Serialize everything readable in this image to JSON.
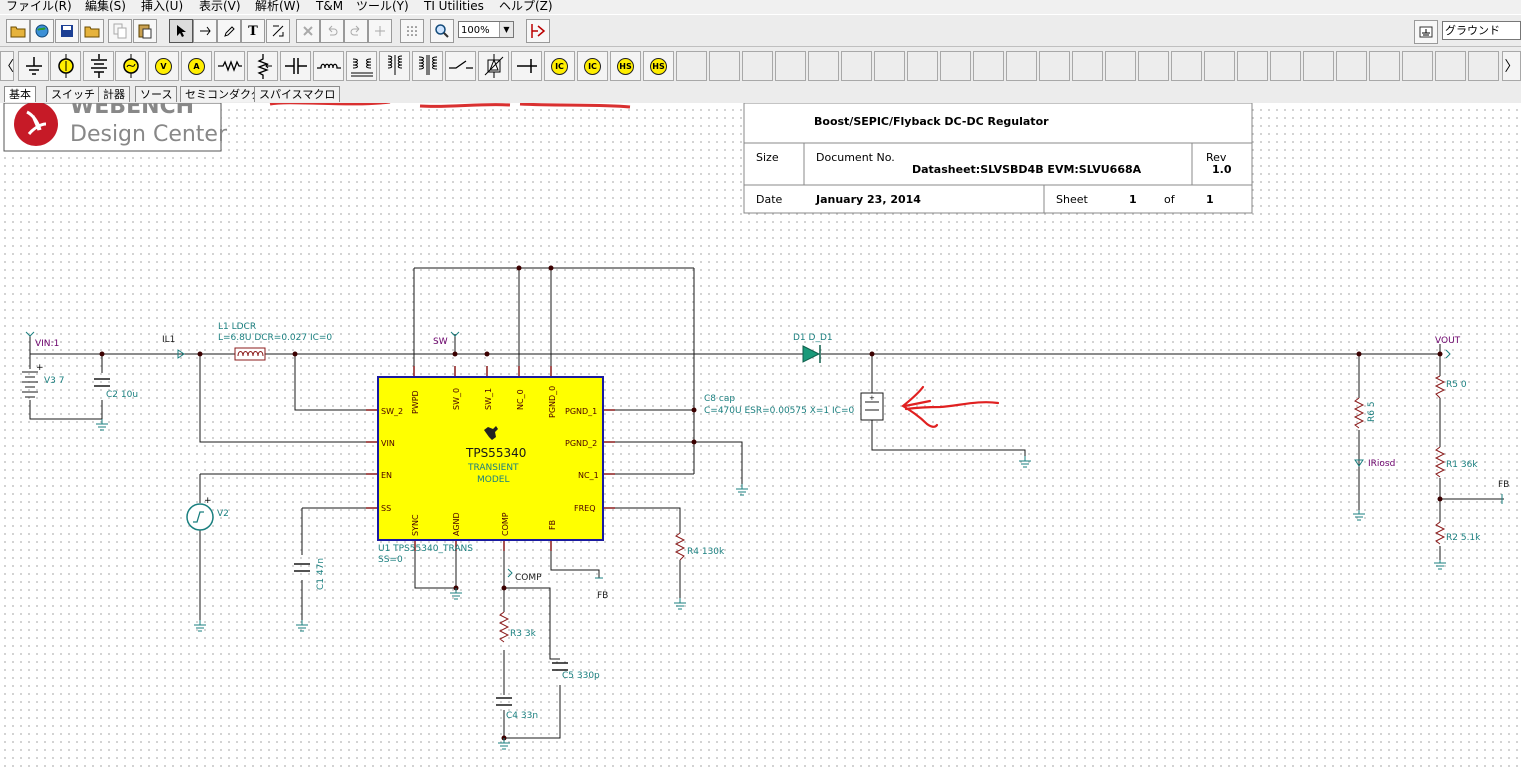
{
  "menu": [
    "ファイル(R)",
    "編集(S)",
    "挿入(U)",
    "表示(V)",
    "解析(W)",
    "T&M",
    "ツール(Y)",
    "TI Utilities",
    "ヘルプ(Z)"
  ],
  "toolbar": {
    "zoom_value": "100%",
    "ground_label": "グラウンド",
    "items": [
      "open-icon",
      "web-icon",
      "save-icon",
      "folder-icon",
      "copy-icon",
      "paste-icon",
      "pointer-icon",
      "wire-icon",
      "pen-icon",
      "text-icon",
      "label-icon",
      "delete-icon",
      "undo-icon",
      "redo-icon",
      "junction-icon",
      "grid-icon",
      "zoom-icon"
    ]
  },
  "component_toolbar": {
    "items": [
      "ground-icon",
      "battery-icon",
      "voltage-source-icon",
      "voltmeter-icon",
      "ammeter-icon",
      "resistor-icon",
      "potentiometer-icon",
      "capacitor-icon",
      "inductor-icon",
      "transformer-icon",
      "switch-icon",
      "diode-icon",
      "current-source-icon"
    ],
    "circle_labels": [
      "V",
      "A",
      "IC",
      "IC",
      "HS",
      "HS"
    ]
  },
  "tabs": [
    "基本",
    "スイッチ",
    "計器",
    "ソース",
    "セミコンダクタ",
    "スパイスマクロ"
  ],
  "logo": {
    "line1": "WEBENCH",
    "line2": "Design Center"
  },
  "title_block": {
    "title": "Boost/SEPIC/Flyback DC-DC Regulator",
    "size_label": "Size",
    "doc_label": "Document No.",
    "doc_value": "Datasheet:SLVSBD4B  EVM:SLVU668A",
    "rev_label": "Rev",
    "rev_value": "1.0",
    "date_label": "Date",
    "date_value": "January 23, 2014",
    "sheet_label": "Sheet",
    "sheet_value": "1",
    "of_label": "of",
    "of_value": "1"
  },
  "ic": {
    "name": "TPS55340",
    "sub1": "TRANSIENT",
    "sub2": "MODEL",
    "pins": {
      "left": [
        "SW_2",
        "VIN",
        "EN",
        "SS"
      ],
      "top": [
        "PWPD",
        "SW_0",
        "SW_1",
        "NC_0",
        "PGND_0"
      ],
      "right": [
        "PGND_1",
        "PGND_2",
        "NC_1",
        "FREQ"
      ],
      "bottom": [
        "SYNC",
        "AGND",
        "COMP",
        "FB"
      ]
    },
    "ref_label": "U1 TPS55340_TRANS",
    "ss_label": "SS=0"
  },
  "labels": {
    "vin": "VIN:1",
    "il1": "IL1",
    "l1": "L1 LDCR",
    "l1_params": "L=6.8U DCR=0.027 IC=0",
    "sw": "SW",
    "v3": "V3 7",
    "c2": "C2 10u",
    "d1": "D1 D_D1",
    "c8": "C8 cap",
    "c8_params": "C=470U ESR=0.00575 X=1 IC=0",
    "vout": "VOUT",
    "r5": "R5 0",
    "r1": "R1 36k",
    "r2": "R2 5.1k",
    "fb_out": "FB",
    "r6": "R6 5",
    "iriosd": "IRiosd",
    "v2": "V2",
    "c1": "C1 47n",
    "r4": "R4 130k",
    "comp": "COMP",
    "fb": "FB",
    "r3": "R3 3k",
    "c5": "C5 330p",
    "c4": "C4 33n",
    "plus": "+"
  }
}
